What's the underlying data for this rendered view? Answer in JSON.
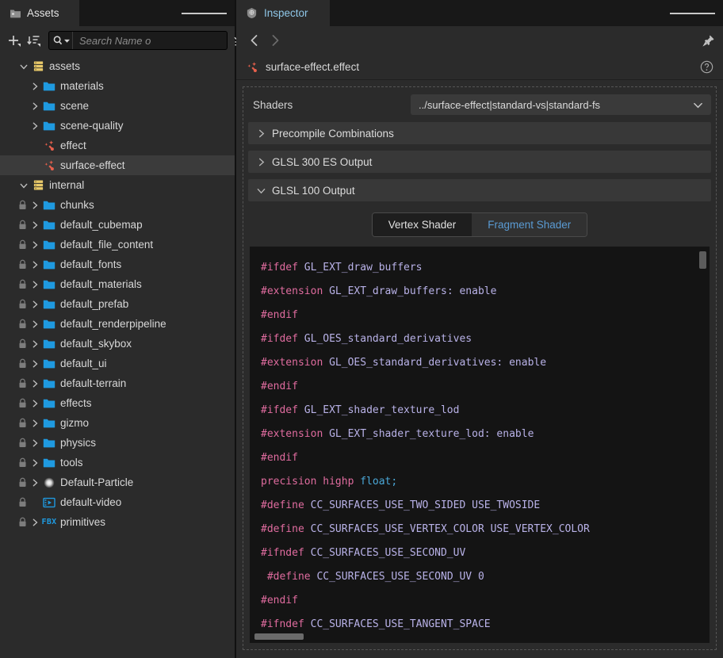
{
  "assets_panel": {
    "tab": {
      "label": "Assets",
      "icon": "folder-icon"
    },
    "menu_icon": "hamburger-menu-icon",
    "toolbar": {
      "add_label": "+",
      "add_icon": "add-dropdown-icon",
      "sort_icon": "sort-dropdown-icon",
      "search_icon": "search-dropdown-icon",
      "filter_icon": "filter-list-icon",
      "refresh_icon": "refresh-icon",
      "search_placeholder": "Search Name o"
    },
    "tree": [
      {
        "label": "assets",
        "depth": 0,
        "icon": "database-icon",
        "arrow": "down",
        "lock": false,
        "selected": false
      },
      {
        "label": "materials",
        "depth": 1,
        "icon": "folder-icon",
        "arrow": "right",
        "lock": false,
        "selected": false
      },
      {
        "label": "scene",
        "depth": 1,
        "icon": "folder-icon",
        "arrow": "right",
        "lock": false,
        "selected": false
      },
      {
        "label": "scene-quality",
        "depth": 1,
        "icon": "folder-icon",
        "arrow": "right",
        "lock": false,
        "selected": false
      },
      {
        "label": "effect",
        "depth": 1,
        "icon": "effect-icon",
        "arrow": "none",
        "lock": false,
        "selected": false
      },
      {
        "label": "surface-effect",
        "depth": 1,
        "icon": "effect-icon",
        "arrow": "none",
        "lock": false,
        "selected": true
      },
      {
        "label": "internal",
        "depth": 0,
        "icon": "database-icon",
        "arrow": "down",
        "lock": false,
        "selected": false
      },
      {
        "label": "chunks",
        "depth": 1,
        "icon": "folder-icon",
        "arrow": "right",
        "lock": true,
        "selected": false
      },
      {
        "label": "default_cubemap",
        "depth": 1,
        "icon": "folder-icon",
        "arrow": "right",
        "lock": true,
        "selected": false
      },
      {
        "label": "default_file_content",
        "depth": 1,
        "icon": "folder-icon",
        "arrow": "right",
        "lock": true,
        "selected": false
      },
      {
        "label": "default_fonts",
        "depth": 1,
        "icon": "folder-icon",
        "arrow": "right",
        "lock": true,
        "selected": false
      },
      {
        "label": "default_materials",
        "depth": 1,
        "icon": "folder-icon",
        "arrow": "right",
        "lock": true,
        "selected": false
      },
      {
        "label": "default_prefab",
        "depth": 1,
        "icon": "folder-icon",
        "arrow": "right",
        "lock": true,
        "selected": false
      },
      {
        "label": "default_renderpipeline",
        "depth": 1,
        "icon": "folder-icon",
        "arrow": "right",
        "lock": true,
        "selected": false
      },
      {
        "label": "default_skybox",
        "depth": 1,
        "icon": "folder-icon",
        "arrow": "right",
        "lock": true,
        "selected": false
      },
      {
        "label": "default_ui",
        "depth": 1,
        "icon": "folder-icon",
        "arrow": "right",
        "lock": true,
        "selected": false
      },
      {
        "label": "default-terrain",
        "depth": 1,
        "icon": "folder-icon",
        "arrow": "right",
        "lock": true,
        "selected": false
      },
      {
        "label": "effects",
        "depth": 1,
        "icon": "folder-icon",
        "arrow": "right",
        "lock": true,
        "selected": false
      },
      {
        "label": "gizmo",
        "depth": 1,
        "icon": "folder-icon",
        "arrow": "right",
        "lock": true,
        "selected": false
      },
      {
        "label": "physics",
        "depth": 1,
        "icon": "folder-icon",
        "arrow": "right",
        "lock": true,
        "selected": false
      },
      {
        "label": "tools",
        "depth": 1,
        "icon": "folder-icon",
        "arrow": "right",
        "lock": true,
        "selected": false
      },
      {
        "label": "Default-Particle",
        "depth": 1,
        "icon": "particle-icon",
        "arrow": "right",
        "lock": true,
        "selected": false
      },
      {
        "label": "default-video",
        "depth": 1,
        "icon": "video-icon",
        "arrow": "none",
        "lock": true,
        "selected": false
      },
      {
        "label": "primitives",
        "depth": 1,
        "icon": "fbx-icon",
        "arrow": "right",
        "lock": true,
        "selected": false
      }
    ]
  },
  "inspector": {
    "tab": {
      "label": "Inspector",
      "icon": "inspector-icon"
    },
    "menu_icon": "hamburger-menu-icon",
    "nav": {
      "back_icon": "chevron-left-icon",
      "forward_icon": "chevron-right-icon",
      "pin_icon": "pin-icon"
    },
    "asset": {
      "name": "surface-effect.effect",
      "icon": "effect-icon",
      "help_icon": "help-icon"
    },
    "shaders": {
      "label": "Shaders",
      "selected_value": "../surface-effect|standard-vs|standard-fs",
      "caret_icon": "chevron-down-icon"
    },
    "sections": [
      {
        "label": "Precompile Combinations",
        "expanded": false
      },
      {
        "label": "GLSL 300 ES Output",
        "expanded": false
      },
      {
        "label": "GLSL 100 Output",
        "expanded": true
      }
    ],
    "shader_tabs": [
      {
        "label": "Vertex Shader",
        "active": true
      },
      {
        "label": "Fragment Shader",
        "active": false
      }
    ],
    "code_lines": [
      [
        {
          "t": "pre",
          "s": "#ifdef"
        },
        {
          "t": "pln",
          "s": " "
        },
        {
          "t": "id",
          "s": "GL_EXT_draw_buffers"
        }
      ],
      [
        {
          "t": "pre",
          "s": "#extension"
        },
        {
          "t": "pln",
          "s": " "
        },
        {
          "t": "id",
          "s": "GL_EXT_draw_buffers: enable"
        }
      ],
      [
        {
          "t": "pre",
          "s": "#endif"
        }
      ],
      [
        {
          "t": "pre",
          "s": "#ifdef"
        },
        {
          "t": "pln",
          "s": " "
        },
        {
          "t": "id",
          "s": "GL_OES_standard_derivatives"
        }
      ],
      [
        {
          "t": "pre",
          "s": "#extension"
        },
        {
          "t": "pln",
          "s": " "
        },
        {
          "t": "id",
          "s": "GL_OES_standard_derivatives: enable"
        }
      ],
      [
        {
          "t": "pre",
          "s": "#endif"
        }
      ],
      [
        {
          "t": "pre",
          "s": "#ifdef"
        },
        {
          "t": "pln",
          "s": " "
        },
        {
          "t": "id",
          "s": "GL_EXT_shader_texture_lod"
        }
      ],
      [
        {
          "t": "pre",
          "s": "#extension"
        },
        {
          "t": "pln",
          "s": " "
        },
        {
          "t": "id",
          "s": "GL_EXT_shader_texture_lod: enable"
        }
      ],
      [
        {
          "t": "pre",
          "s": "#endif"
        }
      ],
      [
        {
          "t": "kw",
          "s": "precision highp"
        },
        {
          "t": "pln",
          "s": " "
        },
        {
          "t": "type",
          "s": "float;"
        }
      ],
      [
        {
          "t": "pre",
          "s": "#define"
        },
        {
          "t": "pln",
          "s": " "
        },
        {
          "t": "id",
          "s": "CC_SURFACES_USE_TWO_SIDED USE_TWOSIDE"
        }
      ],
      [
        {
          "t": "pre",
          "s": "#define"
        },
        {
          "t": "pln",
          "s": " "
        },
        {
          "t": "id",
          "s": "CC_SURFACES_USE_VERTEX_COLOR USE_VERTEX_COLOR"
        }
      ],
      [
        {
          "t": "pre",
          "s": "#ifndef"
        },
        {
          "t": "pln",
          "s": " "
        },
        {
          "t": "id",
          "s": "CC_SURFACES_USE_SECOND_UV"
        }
      ],
      [
        {
          "t": "pln",
          "s": " "
        },
        {
          "t": "pre",
          "s": "#define"
        },
        {
          "t": "pln",
          "s": " "
        },
        {
          "t": "id",
          "s": "CC_SURFACES_USE_SECOND_UV 0"
        }
      ],
      [
        {
          "t": "pre",
          "s": "#endif"
        }
      ],
      [
        {
          "t": "pre",
          "s": "#ifndef"
        },
        {
          "t": "pln",
          "s": " "
        },
        {
          "t": "id",
          "s": "CC_SURFACES_USE_TANGENT_SPACE"
        }
      ]
    ]
  },
  "colors": {
    "panel_bg": "#2b2b2b",
    "tabbar_bg": "#181818",
    "code_bg": "#141414",
    "selected_row": "#3b3b3b",
    "section_bg": "#383838",
    "accent_blue": "#5a9bd4",
    "folder_blue": "#1f9ae0",
    "database_yellow": "#e8c96a",
    "effect_red": "#e8604c"
  }
}
